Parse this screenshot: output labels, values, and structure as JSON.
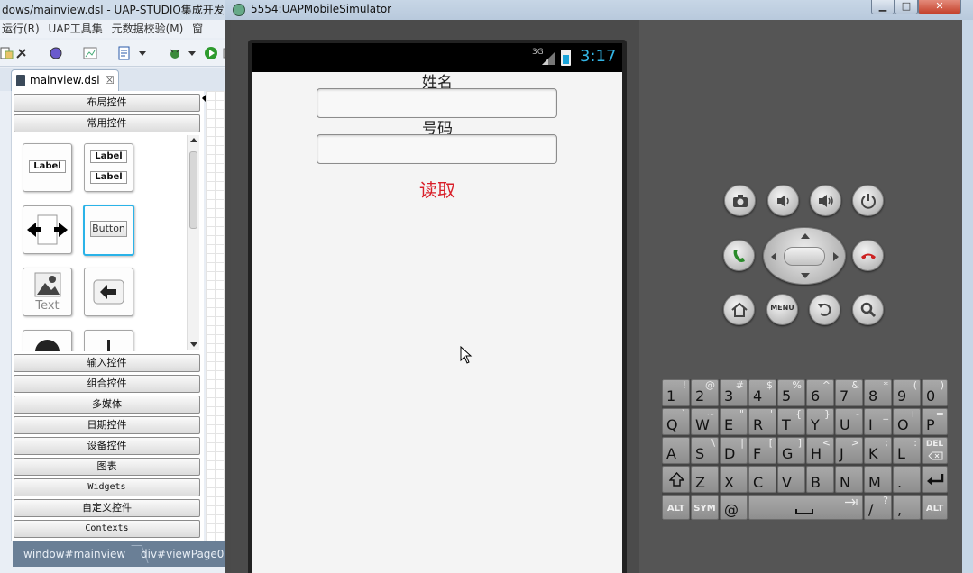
{
  "ide": {
    "title": "dows/mainview.dsl  -  UAP-STUDIO集成开发",
    "menu": [
      "运行(R)",
      "UAP工具集",
      "元数据校验(M)",
      "窗"
    ],
    "editor_tab": "mainview.dsl",
    "editor_tab_close": "☒",
    "palette": {
      "categories_top": [
        "布局控件",
        "常用控件"
      ],
      "controls": {
        "label_single": "Label",
        "label_double": [
          "Label",
          "Label"
        ],
        "button": "Button",
        "image_text": "Text"
      },
      "categories_bottom": [
        "输入控件",
        "组合控件",
        "多媒体",
        "日期控件",
        "设备控件",
        "图表",
        "Widgets",
        "自定义控件",
        "Contexts"
      ]
    },
    "breadcrumbs": [
      "window#mainview",
      "div#viewPage0"
    ]
  },
  "emulator": {
    "title": "5554:UAPMobileSimulator",
    "window_buttons": [
      "▁",
      "□",
      "✕"
    ],
    "status": {
      "network": "3G",
      "time": "3:17"
    },
    "app": {
      "name_label": "姓名",
      "name_value": "",
      "number_label": "号码",
      "number_value": "",
      "read_button": "读取"
    },
    "hardware_buttons": [
      "camera-icon",
      "volume-down-icon",
      "volume-up-icon",
      "power-icon",
      "call-icon",
      "dpad",
      "end-call-icon",
      "home-icon",
      "menu",
      "back-icon",
      "search-icon"
    ],
    "menu_button_label": "MENU",
    "keyboard": {
      "row1": [
        [
          "1",
          "!"
        ],
        [
          "2",
          "@"
        ],
        [
          "3",
          "#"
        ],
        [
          "4",
          "$"
        ],
        [
          "5",
          "%"
        ],
        [
          "6",
          "^"
        ],
        [
          "7",
          "&"
        ],
        [
          "8",
          "*"
        ],
        [
          "9",
          "("
        ],
        [
          "0",
          ")"
        ]
      ],
      "row2": [
        [
          "Q",
          "`"
        ],
        [
          "W",
          "~"
        ],
        [
          "E",
          "\""
        ],
        [
          "R",
          "'"
        ],
        [
          "T",
          "{"
        ],
        [
          "Y",
          "}"
        ],
        [
          "U",
          "-"
        ],
        [
          "I",
          "_"
        ],
        [
          "O",
          "+"
        ],
        [
          "P",
          "="
        ]
      ],
      "row3": [
        [
          "A",
          ""
        ],
        [
          "S",
          "\\"
        ],
        [
          "D",
          "|"
        ],
        [
          "F",
          "["
        ],
        [
          "G",
          "]"
        ],
        [
          "H",
          "<"
        ],
        [
          "J",
          ">"
        ],
        [
          "K",
          ";"
        ],
        [
          "L",
          ":"
        ]
      ],
      "row3_del": "DEL",
      "row4": [
        [
          "Z",
          ""
        ],
        [
          "X",
          ""
        ],
        [
          "C",
          ""
        ],
        [
          "V",
          ""
        ],
        [
          "B",
          ""
        ],
        [
          "N",
          ""
        ],
        [
          "M",
          ""
        ],
        [
          ".",
          ""
        ]
      ],
      "row5": {
        "alt_left": "ALT",
        "sym": "SYM",
        "at": "@",
        "slash": "/",
        "slash_alt": "?",
        "comma": ",",
        "alt_right": "ALT"
      }
    }
  },
  "colors": {
    "accent_red": "#d9202a",
    "clock_blue": "#33b5e5",
    "selection_cyan": "#2bb3e8"
  }
}
